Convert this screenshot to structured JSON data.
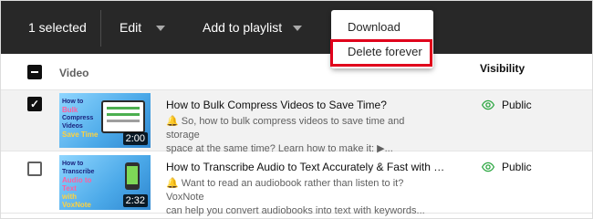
{
  "action_bar": {
    "selected_label": "1 selected",
    "edit_label": "Edit",
    "playlist_label": "Add to playlist"
  },
  "menu": {
    "items": [
      {
        "label": "Download"
      },
      {
        "label": "Delete forever",
        "highlighted": true
      }
    ],
    "highlight_color": "#e0001b"
  },
  "table": {
    "columns": {
      "video": "Video",
      "visibility": "Visibility"
    },
    "rows": [
      {
        "selected": true,
        "thumb_lines": [
          "How to",
          "Bulk",
          "Compress Videos",
          "Save Time"
        ],
        "duration": "2:00",
        "title": "How to Bulk Compress Videos to Save Time?",
        "description_line1": "🔔 So, how to bulk compress videos to save time and storage",
        "description_line2": "space at the same time? Learn how to make it: ▶...",
        "visibility": "Public",
        "visibility_icon": "eye-icon"
      },
      {
        "selected": false,
        "thumb_lines": [
          "How to Transcribe",
          "Audio to Text",
          "with VoxNote"
        ],
        "duration": "2:32",
        "title": "How to Transcribe Audio to Text Accurately & Fast with VoxN...",
        "description_line1": "🔔 Want to read an audiobook rather than listen to it? VoxNote",
        "description_line2": "can help you convert audiobooks into text with keywords...",
        "visibility": "Public",
        "visibility_icon": "eye-icon"
      }
    ]
  },
  "colors": {
    "bar_bg": "#282828",
    "selected_row_bg": "#f2f2f2",
    "public_green": "#2ba640"
  }
}
